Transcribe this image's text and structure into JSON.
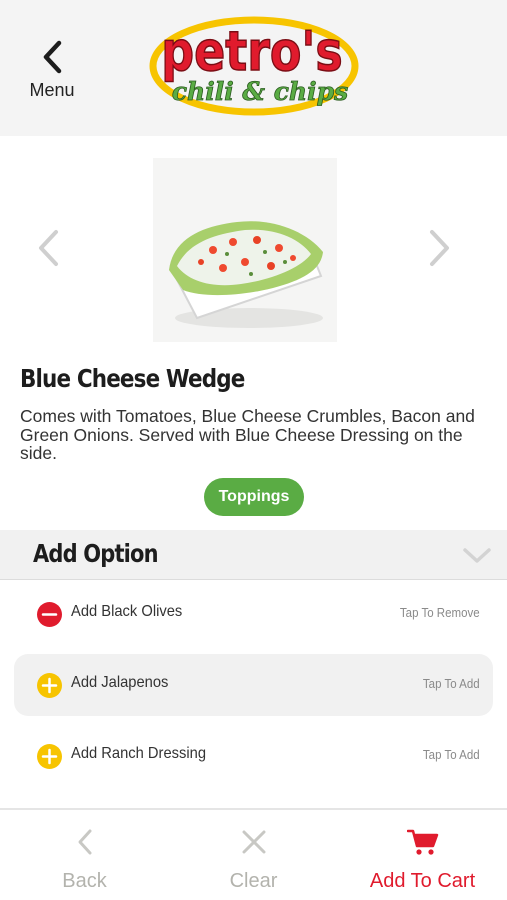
{
  "header": {
    "back_label": "Menu",
    "logo_text_main": "petro's",
    "logo_text_sub": "chili & chips"
  },
  "item": {
    "title": "Blue Cheese Wedge",
    "description": "Comes with Tomatoes, Blue Cheese Crumbles, Bacon and Green Onions. Served with Blue Cheese Dressing on the side.",
    "toppings_button": "Toppings"
  },
  "options_section": {
    "title": "Add Option",
    "items": [
      {
        "label": "Add Black Olives",
        "action": "Tap To Remove",
        "state": "selected",
        "icon": "minus-icon"
      },
      {
        "label": "Add Jalapenos",
        "action": "Tap To Add",
        "state": "unselected",
        "icon": "plus-icon"
      },
      {
        "label": "Add Ranch Dressing",
        "action": "Tap To Add",
        "state": "unselected",
        "icon": "plus-icon"
      }
    ]
  },
  "bottom_bar": {
    "back_label": "Back",
    "clear_label": "Clear",
    "cart_label": "Add To Cart"
  },
  "colors": {
    "brand_red": "#e01b2d",
    "brand_green": "#5aac44",
    "logo_yellow": "#f7c400",
    "add_yellow": "#f7c400",
    "muted_gray": "#b3b3ad"
  }
}
